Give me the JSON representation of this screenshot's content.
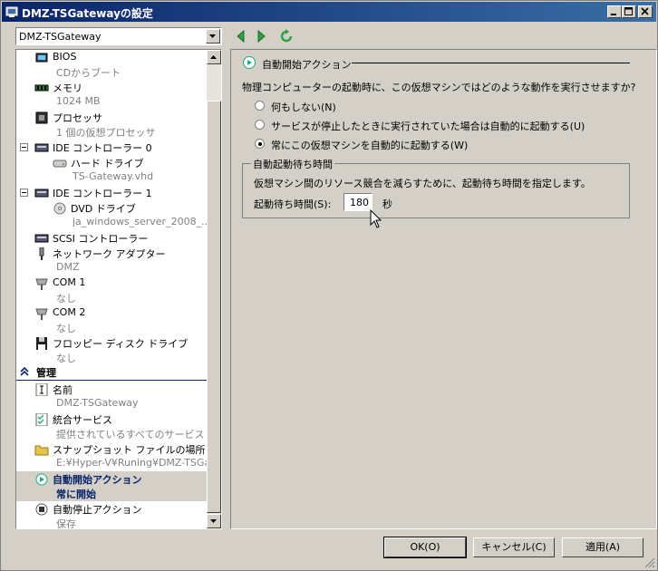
{
  "window": {
    "title": "DMZ-TSGatewayの設定"
  },
  "vm_selector": {
    "value": "DMZ-TSGateway"
  },
  "left_items": [
    {
      "label": "BIOS",
      "sub": "CDからブート"
    },
    {
      "label": "メモリ",
      "sub": "1024 MB"
    },
    {
      "label": "プロセッサ",
      "sub": "1 個の仮想プロセッサ"
    },
    {
      "label": "IDE コントローラー 0",
      "sub": ""
    },
    {
      "label": "ハード ドライブ",
      "sub": "TS-Gateway.vhd"
    },
    {
      "label": "IDE コントローラー 1",
      "sub": ""
    },
    {
      "label": "DVD ドライブ",
      "sub": "ja_windows_server_2008_..."
    },
    {
      "label": "SCSI コントローラー",
      "sub": ""
    },
    {
      "label": "ネットワーク アダプター",
      "sub": "DMZ"
    },
    {
      "label": "COM 1",
      "sub": "なし"
    },
    {
      "label": "COM 2",
      "sub": "なし"
    },
    {
      "label": "フロッピー ディスク ドライブ",
      "sub": "なし"
    }
  ],
  "management": {
    "title": "管理",
    "items": [
      {
        "label": "名前",
        "sub": "DMZ-TSGateway"
      },
      {
        "label": "統合サービス",
        "sub": "提供されているすべてのサービス"
      },
      {
        "label": "スナップショット ファイルの場所",
        "sub": "E:¥Hyper-V¥Runing¥DMZ-TSGa..."
      },
      {
        "label": "自動開始アクション",
        "sub": "常に開始"
      },
      {
        "label": "自動停止アクション",
        "sub": "保存"
      }
    ]
  },
  "panel": {
    "heading": "自動開始アクション",
    "question": "物理コンピューターの起動時に、この仮想マシンではどのような動作を実行させますか?",
    "options": [
      "何もしない(N)",
      "サービスが停止したときに実行されていた場合は自動的に起動する(U)",
      "常にこの仮想マシンを自動的に起動する(W)"
    ],
    "selected_option": 2,
    "delay": {
      "group_label": "自動起動待ち時間",
      "description": "仮想マシン間のリソース競合を減らすために、起動待ち時間を指定します。",
      "label": "起動待ち時間(S):",
      "value": "180",
      "unit": "秒"
    }
  },
  "buttons": {
    "ok": "OK(O)",
    "cancel": "キャンセル(C)",
    "apply": "適用(A)"
  },
  "colors": {
    "titlebar": "#0a246a",
    "selection_text": "#0a246a",
    "nav_arrow": "#2ea043"
  }
}
